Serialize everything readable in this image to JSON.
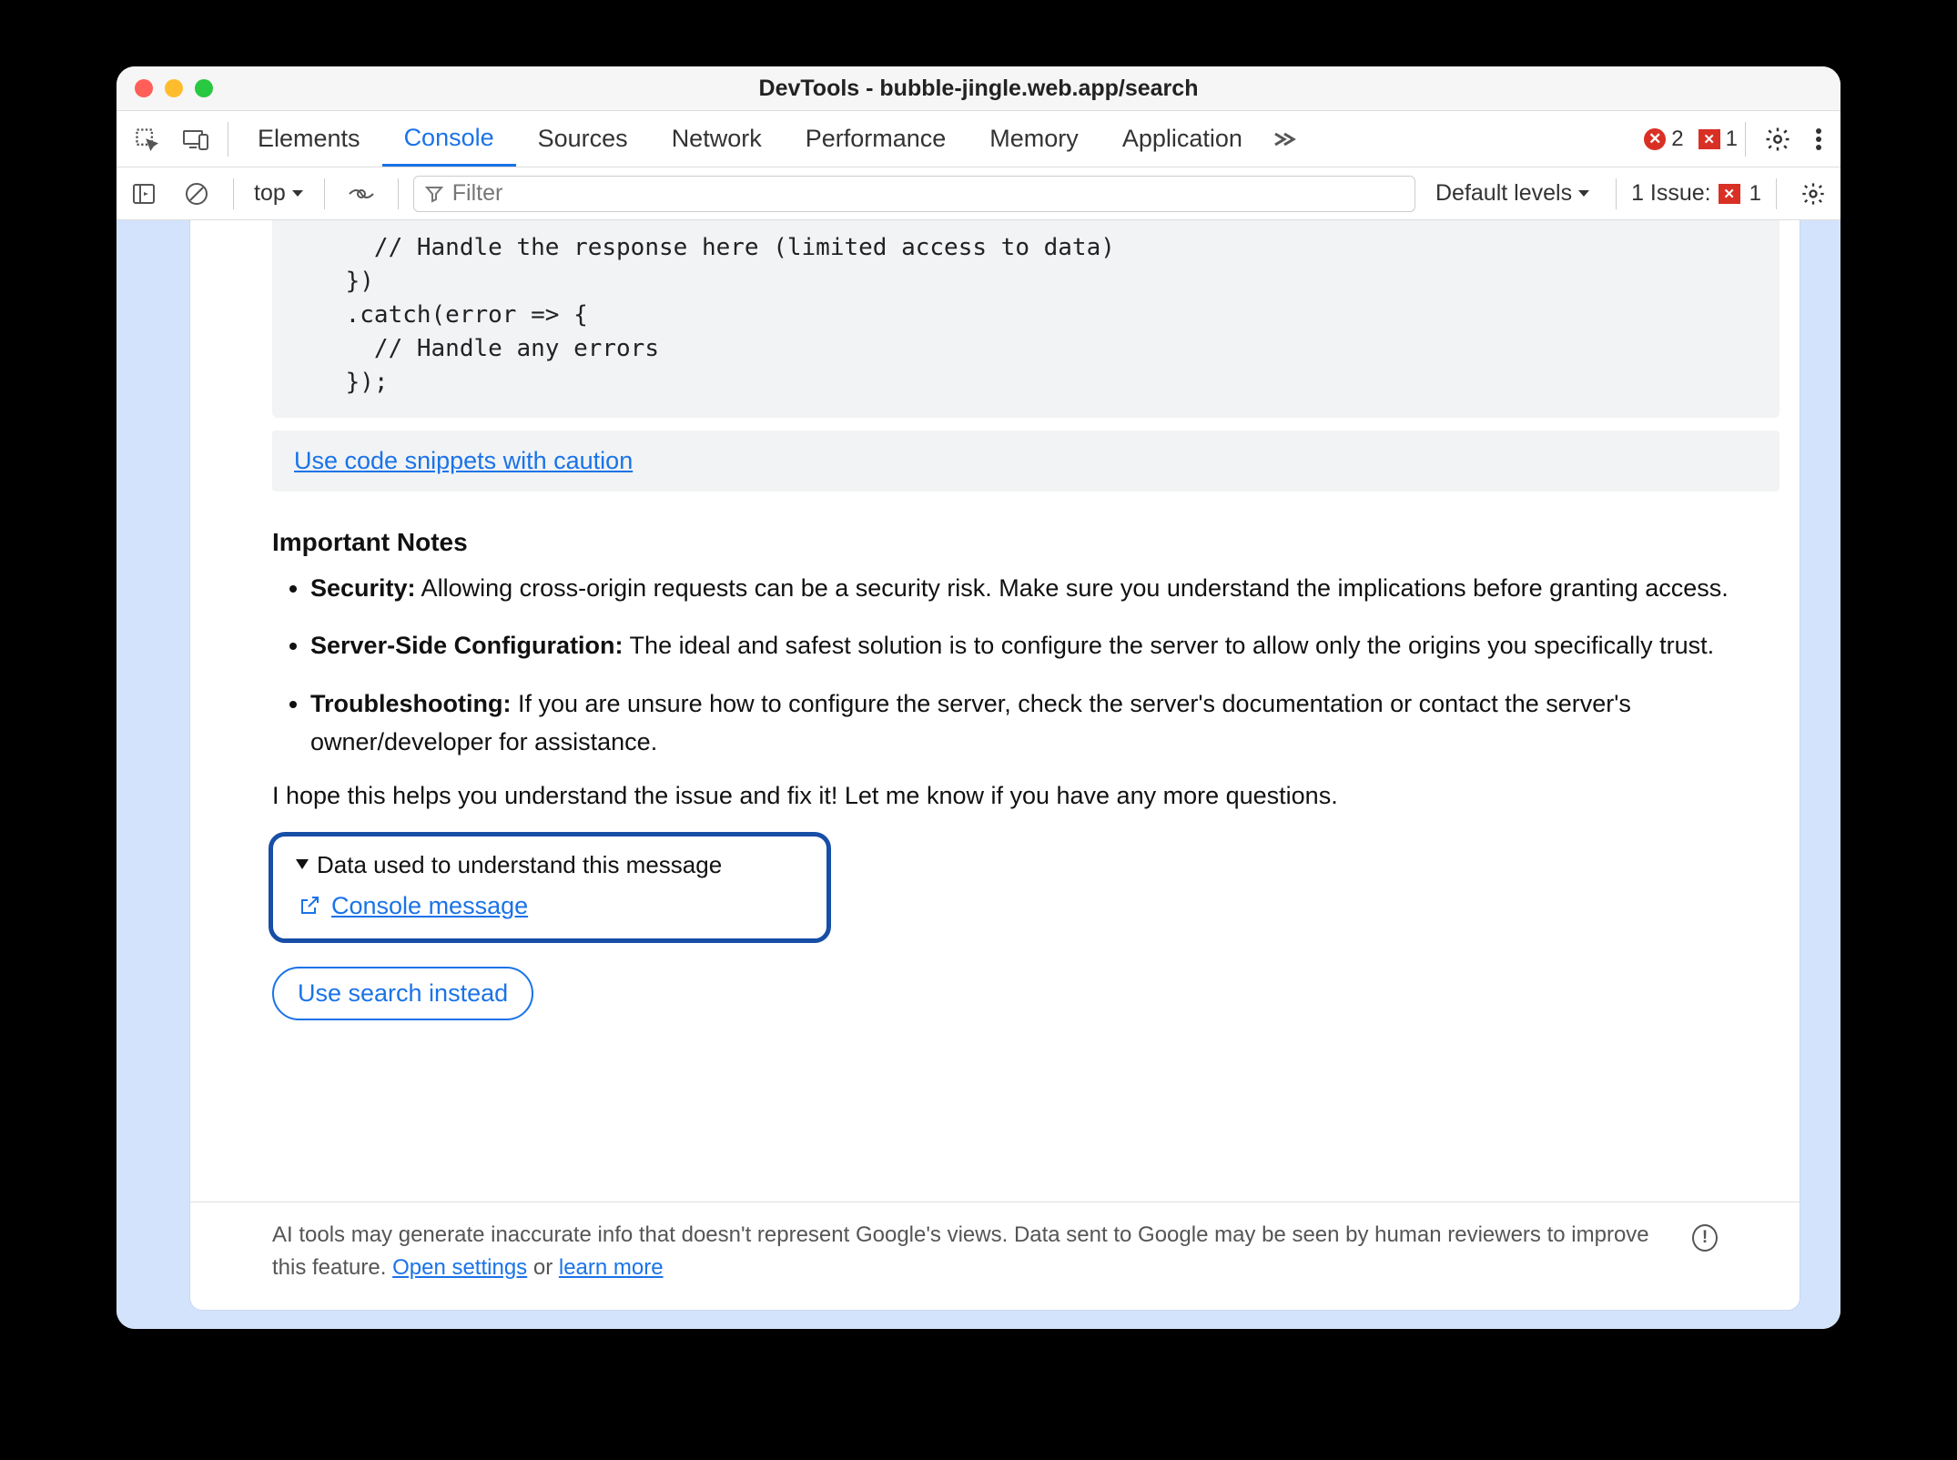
{
  "titlebar": {
    "title": "DevTools - bubble-jingle.web.app/search"
  },
  "tabs": {
    "items": [
      "Elements",
      "Console",
      "Sources",
      "Network",
      "Performance",
      "Memory",
      "Application"
    ],
    "active_index": 1,
    "errors_count": "2",
    "flag_count": "1"
  },
  "subbar": {
    "context": "top",
    "filter_placeholder": "Filter",
    "levels_label": "Default levels",
    "issue_label": "1 Issue:",
    "issue_count": "1"
  },
  "code": "      // Handle the response here (limited access to data)\n    })\n    .catch(error => {\n      // Handle any errors\n    });",
  "caution_link": "Use code snippets with caution",
  "notes_title": "Important Notes",
  "notes": [
    {
      "bold": "Security:",
      "text": " Allowing cross-origin requests can be a security risk. Make sure you understand the implications before granting access."
    },
    {
      "bold": "Server-Side Configuration:",
      "text": " The ideal and safest solution is to configure the server to allow only the origins you specifically trust."
    },
    {
      "bold": "Troubleshooting:",
      "text": " If you are unsure how to configure the server, check the server's documentation or contact the server's owner/developer for assistance."
    }
  ],
  "closing": "I hope this helps you understand the issue and fix it! Let me know if you have any more questions.",
  "disclosure_label": "Data used to understand this message",
  "console_message_link": "Console message",
  "use_search_label": "Use search instead",
  "footer": {
    "text_pre": "AI tools may generate inaccurate info that doesn't represent Google's views. Data sent to Google may be seen by human reviewers to improve this feature. ",
    "open_settings": "Open settings",
    "or": " or ",
    "learn_more": "learn more"
  }
}
